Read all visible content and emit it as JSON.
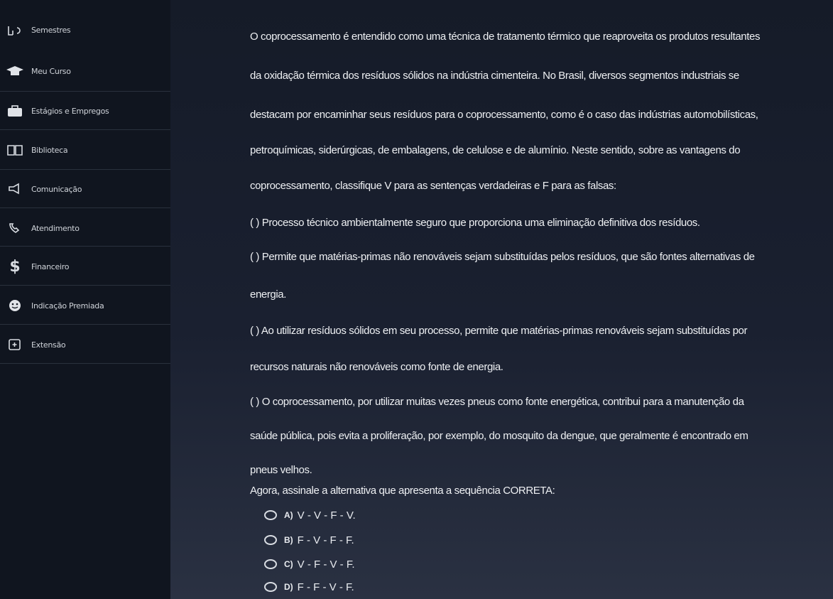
{
  "sidebar": {
    "items": [
      {
        "icon": "semesters-icon",
        "glyph": "⟨⟩",
        "label": "Semestres"
      },
      {
        "icon": "graduation-cap-icon",
        "glyph": "🎓",
        "label": "Meu Curso"
      },
      {
        "icon": "briefcase-icon",
        "glyph": "💼",
        "label": "Estágios e Empregos"
      },
      {
        "icon": "book-icon",
        "glyph": "📖",
        "label": "Biblioteca"
      },
      {
        "icon": "megaphone-icon",
        "glyph": "📢",
        "label": "Comunicação"
      },
      {
        "icon": "headset-icon",
        "glyph": "🎧",
        "label": "Atendimento"
      },
      {
        "icon": "dollar-icon",
        "glyph": "$",
        "label": "Financeiro"
      },
      {
        "icon": "referral-icon",
        "glyph": "☺",
        "label": "Indicação Premiada"
      },
      {
        "icon": "extension-icon",
        "glyph": "⊞",
        "label": "Extensão"
      }
    ]
  },
  "question": {
    "lines": [
      "O coprocessamento é entendido como uma técnica de tratamento térmico que reaproveita os produtos resultantes",
      "da oxidação térmica dos resíduos sólidos na indústria cimenteira. No Brasil, diversos segmentos industriais se",
      "destacam por encaminhar seus resíduos para o coprocessamento, como é o caso das indústrias automobilísticas,",
      "petroquímicas, siderúrgicas, de embalagens, de celulose e de alumínio. Neste sentido, sobre as vantagens do",
      "coprocessamento, classifique V para as sentenças verdadeiras e F para as falsas:",
      "( ) Processo técnico ambientalmente seguro que proporciona uma eliminação definitiva dos resíduos.",
      "( ) Permite que matérias-primas não renováveis sejam substituídas pelos resíduos, que são fontes alternativas de",
      "energia.",
      "( ) Ao utilizar resíduos sólidos em seu processo, permite que matérias-primas renováveis sejam substituídas por",
      "recursos naturais não renováveis como fonte de energia.",
      "( ) O coprocessamento, por utilizar muitas vezes pneus como fonte energética, contribui para a manutenção da",
      "saúde pública, pois evita a proliferação, por exemplo, do mosquito da dengue, que geralmente é encontrado em",
      "pneus velhos.",
      "Agora, assinale a alternativa que apresenta a sequência CORRETA:"
    ]
  },
  "options": [
    {
      "key": "A)",
      "text": "V - V - F - V."
    },
    {
      "key": "B)",
      "text": "F - V - F - F."
    },
    {
      "key": "C)",
      "text": "V - F - V - F."
    },
    {
      "key": "D)",
      "text": "F - F - V - F."
    }
  ]
}
